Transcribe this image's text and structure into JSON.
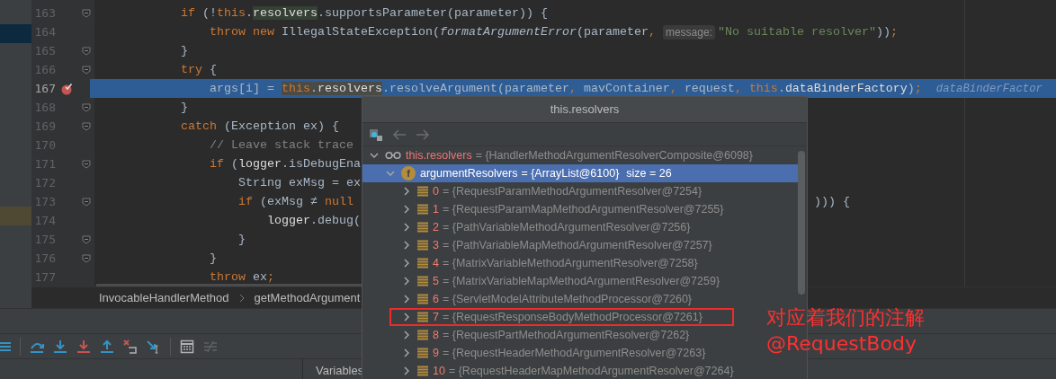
{
  "editor": {
    "lines": [
      {
        "number": "163",
        "fold_marker": true,
        "breakpoint": false,
        "current": false,
        "tokens": [
          {
            "text": "            if",
            "kind": "keyword"
          },
          {
            "text": " (!",
            "kind": "plain"
          },
          {
            "text": "this",
            "kind": "keyword"
          },
          {
            "text": ".",
            "kind": "plain"
          },
          {
            "text": "resolvers",
            "kind": "field",
            "highlighted": true
          },
          {
            "text": ".supportsParameter(parameter)) {",
            "kind": "plain"
          }
        ]
      },
      {
        "number": "164",
        "fold_marker": false,
        "breakpoint": false,
        "current": false,
        "tokens": [
          {
            "text": "                throw new",
            "kind": "keyword"
          },
          {
            "text": " IllegalStateException(",
            "kind": "plain"
          },
          {
            "text": "formatArgumentError",
            "kind": "italic"
          },
          {
            "text": "(parameter",
            "kind": "plain"
          },
          {
            "text": ", ",
            "kind": "keyword"
          },
          {
            "text": "message:",
            "kind": "hint"
          },
          {
            "text": "\"No suitable resolver\"",
            "kind": "string"
          },
          {
            "text": "))",
            "kind": "plain"
          },
          {
            "text": ";",
            "kind": "keyword"
          }
        ]
      },
      {
        "number": "165",
        "fold_marker": true,
        "breakpoint": false,
        "current": false,
        "tokens": [
          {
            "text": "            }",
            "kind": "plain"
          }
        ]
      },
      {
        "number": "166",
        "fold_marker": true,
        "breakpoint": false,
        "current": false,
        "tokens": [
          {
            "text": "            try",
            "kind": "keyword"
          },
          {
            "text": " {",
            "kind": "plain"
          }
        ]
      },
      {
        "number": "167",
        "fold_marker": false,
        "breakpoint": true,
        "current": true,
        "tokens": [
          {
            "text": "                args[i] = ",
            "kind": "plain"
          },
          {
            "text": "this",
            "kind": "keyword",
            "highlighted": true
          },
          {
            "text": ".",
            "kind": "plain",
            "highlighted": true
          },
          {
            "text": "resolvers",
            "kind": "field",
            "highlighted": true
          },
          {
            "text": ".resolveArgument(parameter",
            "kind": "plain"
          },
          {
            "text": ", ",
            "kind": "keyword"
          },
          {
            "text": "mavContainer",
            "kind": "plain"
          },
          {
            "text": ", ",
            "kind": "keyword"
          },
          {
            "text": "request",
            "kind": "plain"
          },
          {
            "text": ", ",
            "kind": "keyword"
          },
          {
            "text": "this",
            "kind": "keyword"
          },
          {
            "text": ".",
            "kind": "plain"
          },
          {
            "text": "dataBinderFactory",
            "kind": "field"
          },
          {
            "text": ")",
            "kind": "plain"
          },
          {
            "text": ";",
            "kind": "keyword"
          },
          {
            "text": "dataBinderFactor",
            "kind": "value_hint"
          }
        ]
      },
      {
        "number": "168",
        "fold_marker": true,
        "breakpoint": false,
        "current": false,
        "tokens": [
          {
            "text": "            }",
            "kind": "plain"
          }
        ]
      },
      {
        "number": "169",
        "fold_marker": true,
        "breakpoint": false,
        "current": false,
        "tokens": [
          {
            "text": "            catch",
            "kind": "keyword"
          },
          {
            "text": " (Exception ex) {",
            "kind": "plain"
          }
        ]
      },
      {
        "number": "170",
        "fold_marker": false,
        "breakpoint": false,
        "current": false,
        "tokens": [
          {
            "text": "                // Leave stack trace",
            "kind": "comment"
          }
        ]
      },
      {
        "number": "171",
        "fold_marker": true,
        "breakpoint": false,
        "current": false,
        "tokens": [
          {
            "text": "                if",
            "kind": "keyword"
          },
          {
            "text": " (",
            "kind": "plain"
          },
          {
            "text": "logger",
            "kind": "field"
          },
          {
            "text": ".isDebugEna",
            "kind": "plain"
          }
        ]
      },
      {
        "number": "172",
        "fold_marker": false,
        "breakpoint": false,
        "current": false,
        "tokens": [
          {
            "text": "                    String exMsg = ex",
            "kind": "plain"
          }
        ]
      },
      {
        "number": "173",
        "fold_marker": true,
        "breakpoint": false,
        "current": false,
        "tokens": [
          {
            "text": "                    if",
            "kind": "keyword"
          },
          {
            "text": " (exMsg ≠ ",
            "kind": "plain"
          },
          {
            "text": "null",
            "kind": "keyword"
          }
        ],
        "tail_tokens": [
          {
            "text": "))) {",
            "kind": "plain"
          }
        ]
      },
      {
        "number": "174",
        "fold_marker": false,
        "breakpoint": false,
        "current": false,
        "tokens": [
          {
            "text": "                        logger",
            "kind": "field"
          },
          {
            "text": ".debug(",
            "kind": "plain"
          }
        ]
      },
      {
        "number": "175",
        "fold_marker": true,
        "breakpoint": false,
        "current": false,
        "tokens": [
          {
            "text": "                    }",
            "kind": "plain"
          }
        ]
      },
      {
        "number": "176",
        "fold_marker": true,
        "breakpoint": false,
        "current": false,
        "tokens": [
          {
            "text": "                }",
            "kind": "plain"
          }
        ]
      },
      {
        "number": "177",
        "fold_marker": false,
        "breakpoint": false,
        "current": false,
        "tokens": [
          {
            "text": "                throw",
            "kind": "keyword"
          },
          {
            "text": " ex",
            "kind": "plain"
          },
          {
            "text": ";",
            "kind": "keyword"
          }
        ]
      }
    ],
    "breadcrumbs": [
      "InvocableHandlerMethod",
      "getMethodArgument"
    ]
  },
  "debug_toolbar": [
    {
      "kind": "menu",
      "disabled": false
    },
    {
      "kind": "separator"
    },
    {
      "kind": "step-over",
      "disabled": false
    },
    {
      "kind": "step-into",
      "disabled": false
    },
    {
      "kind": "force-step-into",
      "disabled": false
    },
    {
      "kind": "step-out",
      "disabled": false
    },
    {
      "kind": "drop-frame",
      "disabled": false
    },
    {
      "kind": "run-to-cursor",
      "disabled": false
    },
    {
      "kind": "separator"
    },
    {
      "kind": "evaluate",
      "disabled": false
    },
    {
      "kind": "trace",
      "disabled": true
    }
  ],
  "panel_header": {
    "title": "Variables"
  },
  "popup": {
    "title": "this.resolvers",
    "toolbar": [
      {
        "kind": "variables",
        "disabled": false
      },
      {
        "kind": "back",
        "disabled": true
      },
      {
        "kind": "forward",
        "disabled": true
      }
    ],
    "tree": [
      {
        "kind": "watch",
        "name": "this.resolvers",
        "value": "= {HandlerMethodArgumentResolverComposite@6098}",
        "expanded": true,
        "selected": false,
        "children": [
          {
            "kind": "field",
            "badge": "f",
            "name": "argumentResolvers",
            "value": "= {ArrayList@6100}",
            "size": "size = 26",
            "expanded": true,
            "selected": true,
            "children": [
              {
                "kind": "element",
                "name": "0",
                "value": "= {RequestParamMethodArgumentResolver@7254}",
                "expanded": false,
                "selected": false,
                "boxed": false
              },
              {
                "kind": "element",
                "name": "1",
                "value": "= {RequestParamMapMethodArgumentResolver@7255}",
                "expanded": false,
                "selected": false,
                "boxed": false
              },
              {
                "kind": "element",
                "name": "2",
                "value": "= {PathVariableMethodArgumentResolver@7256}",
                "expanded": false,
                "selected": false,
                "boxed": false
              },
              {
                "kind": "element",
                "name": "3",
                "value": "= {PathVariableMapMethodArgumentResolver@7257}",
                "expanded": false,
                "selected": false,
                "boxed": false
              },
              {
                "kind": "element",
                "name": "4",
                "value": "= {MatrixVariableMethodArgumentResolver@7258}",
                "expanded": false,
                "selected": false,
                "boxed": false
              },
              {
                "kind": "element",
                "name": "5",
                "value": "= {MatrixVariableMapMethodArgumentResolver@7259}",
                "expanded": false,
                "selected": false,
                "boxed": false
              },
              {
                "kind": "element",
                "name": "6",
                "value": "= {ServletModelAttributeMethodProcessor@7260}",
                "expanded": false,
                "selected": false,
                "boxed": false
              },
              {
                "kind": "element",
                "name": "7",
                "value": "= {RequestResponseBodyMethodProcessor@7261}",
                "expanded": false,
                "selected": false,
                "boxed": true
              },
              {
                "kind": "element",
                "name": "8",
                "value": "= {RequestPartMethodArgumentResolver@7262}",
                "expanded": false,
                "selected": false,
                "boxed": false
              },
              {
                "kind": "element",
                "name": "9",
                "value": "= {RequestHeaderMethodArgumentResolver@7263}",
                "expanded": false,
                "selected": false,
                "boxed": false
              },
              {
                "kind": "element",
                "name": "10",
                "value": "= {RequestHeaderMapMethodArgumentResolver@7264}",
                "expanded": false,
                "selected": false,
                "boxed": false
              }
            ]
          }
        ]
      }
    ]
  },
  "annotation": {
    "lines": [
      "对应着我们的注解",
      "@RequestBody"
    ]
  }
}
